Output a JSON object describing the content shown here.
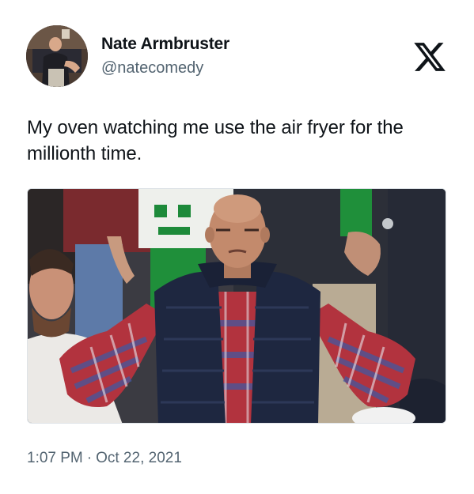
{
  "author": {
    "display_name": "Nate Armbruster",
    "handle": "@natecomedy",
    "avatar_icon": "person-photo"
  },
  "platform_icon": "x-logo-icon",
  "tweet": {
    "text": "My oven watching me use the air fryer for the millionth time."
  },
  "media": {
    "description_icon": "photo"
  },
  "meta": {
    "time": "1:07 PM",
    "separator": "·",
    "date": "Oct 22, 2021"
  },
  "colors": {
    "text_primary": "#0f1419",
    "text_secondary": "#536471",
    "border": "#dfe4e8"
  }
}
